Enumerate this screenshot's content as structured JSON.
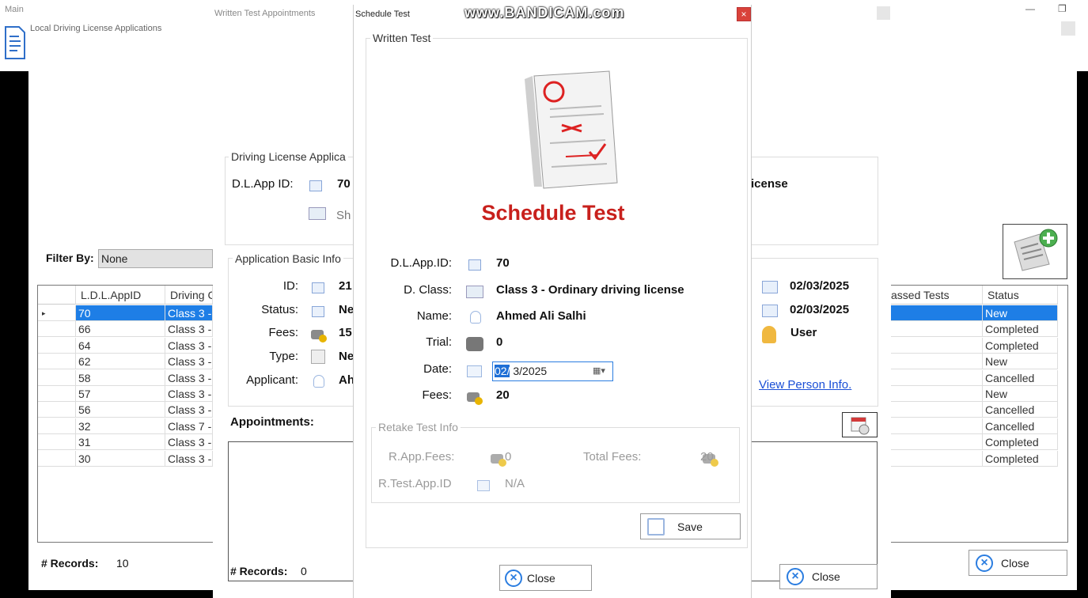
{
  "watermark": "www.BANDICAM.com",
  "main_window": {
    "title": "Main",
    "menu_item": "Local Driving License Applications"
  },
  "ldla_list": {
    "filter_label": "Filter By:",
    "filter_value": "None",
    "columns": [
      "L.D.L.AppID",
      "Driving C",
      "assed Tests",
      "Status"
    ],
    "rows": [
      {
        "id": "70",
        "class": "Class 3 -",
        "status": "New"
      },
      {
        "id": "66",
        "class": "Class 3 -",
        "status": "Completed"
      },
      {
        "id": "64",
        "class": "Class 3 -",
        "status": "Completed"
      },
      {
        "id": "62",
        "class": "Class 3 -",
        "status": "New"
      },
      {
        "id": "58",
        "class": "Class 3 -",
        "status": "Cancelled"
      },
      {
        "id": "57",
        "class": "Class 3 -",
        "status": "New"
      },
      {
        "id": "56",
        "class": "Class 3 -",
        "status": "Cancelled"
      },
      {
        "id": "32",
        "class": "Class 7 -",
        "status": "Cancelled"
      },
      {
        "id": "31",
        "class": "Class 3 -",
        "status": "Completed"
      },
      {
        "id": "30",
        "class": "Class 3 -",
        "status": "Completed"
      }
    ],
    "records_label": "# Records:",
    "records_value": "10",
    "close_label": "Close"
  },
  "appointments_window": {
    "title": "Written Test Appointments",
    "dl_group_title": "Driving License Applica",
    "dl_app_id_label": "D.L.App ID:",
    "dl_app_id_value": "70",
    "show_link_partial": "Sh",
    "license_partial": "icense",
    "basic_group_title": "Application Basic Info",
    "id_label": "ID:",
    "id_value": "21",
    "status_label": "Status:",
    "status_value": "Ne",
    "fees_label": "Fees:",
    "fees_value": "15",
    "type_label": "Type:",
    "type_value": "Ne",
    "applicant_label": "Applicant:",
    "applicant_value": "Ah",
    "date1": "02/03/2025",
    "date2": "02/03/2025",
    "user": "User",
    "view_person": "View Person Info.",
    "appointments_label": "Appointments:",
    "records_label": "# Records:",
    "records_value": "0",
    "close_label": "Close"
  },
  "schedule_dialog": {
    "title": "Schedule Test",
    "group_title": "Written Test",
    "heading": "Schedule Test",
    "dl_app_id_label": "D.L.App.ID:",
    "dl_app_id_value": "70",
    "class_label": "D. Class:",
    "class_value": "Class 3 - Ordinary driving license",
    "name_label": "Name:",
    "name_value": "Ahmed Ali  Salhi",
    "trial_label": "Trial:",
    "trial_value": "0",
    "date_label": "Date:",
    "date_month": "02/",
    "date_rest": " 3/2025",
    "fees_label": "Fees:",
    "fees_value": "20",
    "retake_title": "Retake Test Info",
    "rapp_fees_label": "R.App.Fees:",
    "rapp_fees_value": "0",
    "total_fees_label": "Total Fees:",
    "total_fees_value": "20",
    "rtest_id_label": "R.Test.App.ID",
    "rtest_id_value": "N/A",
    "save_label": "Save",
    "close_label": "Close"
  },
  "colors": {
    "selection": "#1e7ee6",
    "heading_red": "#c8201c",
    "link_blue": "#1a4fd6"
  }
}
